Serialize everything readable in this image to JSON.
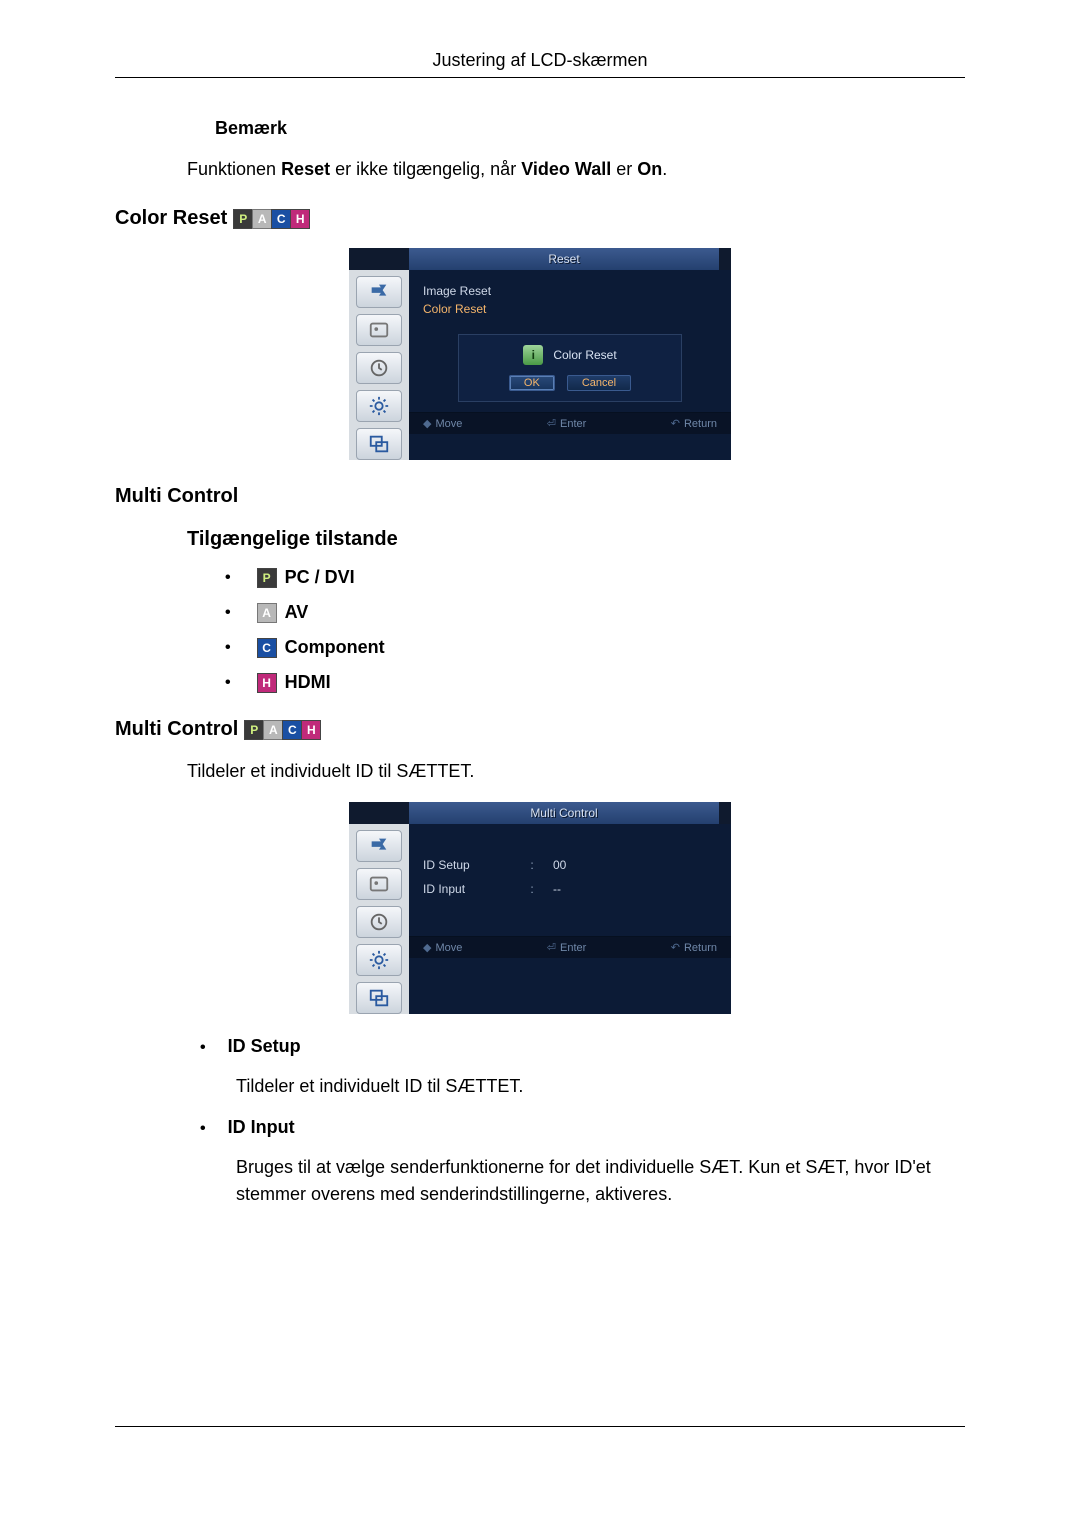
{
  "header": {
    "title": "Justering af LCD-skærmen"
  },
  "note": {
    "heading": "Bemærk",
    "pre": "Funktionen ",
    "b1": "Reset",
    "mid": " er ikke tilgængelig, når ",
    "b2": "Video Wall",
    "post": " er ",
    "b3": "On",
    "tail": "."
  },
  "color_reset": {
    "title": "Color Reset",
    "osd": {
      "title": "Reset",
      "items": [
        "Image Reset",
        "Color Reset"
      ],
      "dialog_label": "Color Reset",
      "ok": "OK",
      "cancel": "Cancel",
      "footer": {
        "move": "Move",
        "enter": "Enter",
        "return": "Return"
      }
    }
  },
  "multi_control": {
    "title": "Multi Control",
    "modes_heading": "Tilgængelige tilstande",
    "modes": {
      "pc": "PC / DVI",
      "av": "AV",
      "component": "Component",
      "hdmi": "HDMI"
    }
  },
  "multi_control_detail": {
    "title": "Multi Control",
    "intro": "Tildeler et individuelt ID til SÆTTET.",
    "osd": {
      "title": "Multi Control",
      "rows": [
        {
          "label": "ID Setup",
          "value": "00"
        },
        {
          "label": "ID Input",
          "value": "--"
        }
      ],
      "footer": {
        "move": "Move",
        "enter": "Enter",
        "return": "Return"
      }
    },
    "items": [
      {
        "name": "ID Setup",
        "body": "Tildeler et individuelt ID til SÆTTET."
      },
      {
        "name": "ID Input",
        "body": "Bruges til at vælge senderfunktionerne for det individuelle SÆT. Kun et SÆT, hvor ID'et stemmer overens med senderindstillingerne, aktiveres."
      }
    ]
  }
}
